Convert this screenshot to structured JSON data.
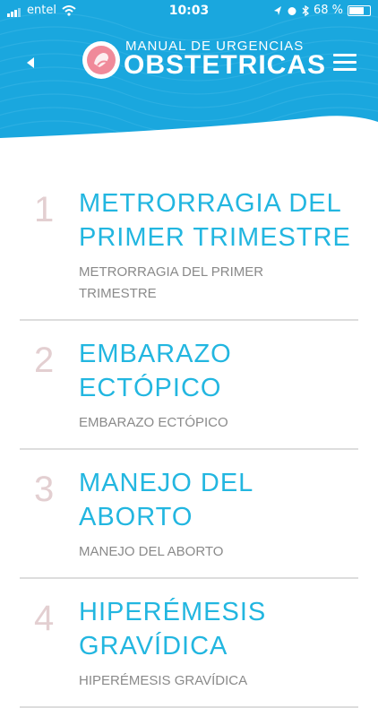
{
  "status_bar": {
    "carrier": "entel",
    "time": "10:03",
    "battery": "68 %",
    "icons": [
      "signal-icon",
      "wifi-icon",
      "location-icon",
      "alarm-icon",
      "bluetooth-icon",
      "battery-icon"
    ]
  },
  "header": {
    "title_top": "MANUAL DE URGENCIAS",
    "title_main": "OBSTETRICAS",
    "brand_color": "#1aa7de"
  },
  "items": [
    {
      "number": "1",
      "title": "METRORRAGIA DEL PRIMER TRIMESTRE",
      "subtitle": "METRORRAGIA DEL PRIMER TRIMESTRE"
    },
    {
      "number": "2",
      "title": "EMBARAZO ECTÓPICO",
      "subtitle": "EMBARAZO ECTÓPICO"
    },
    {
      "number": "3",
      "title": "MANEJO DEL ABORTO",
      "subtitle": "MANEJO DEL ABORTO"
    },
    {
      "number": "4",
      "title": "HIPERÉMESIS GRAVÍDICA",
      "subtitle": "HIPERÉMESIS GRAVÍDICA"
    }
  ],
  "colors": {
    "accent": "#22b6e0",
    "number": "#e3cfd1",
    "subtitle": "#8a8a8a"
  }
}
